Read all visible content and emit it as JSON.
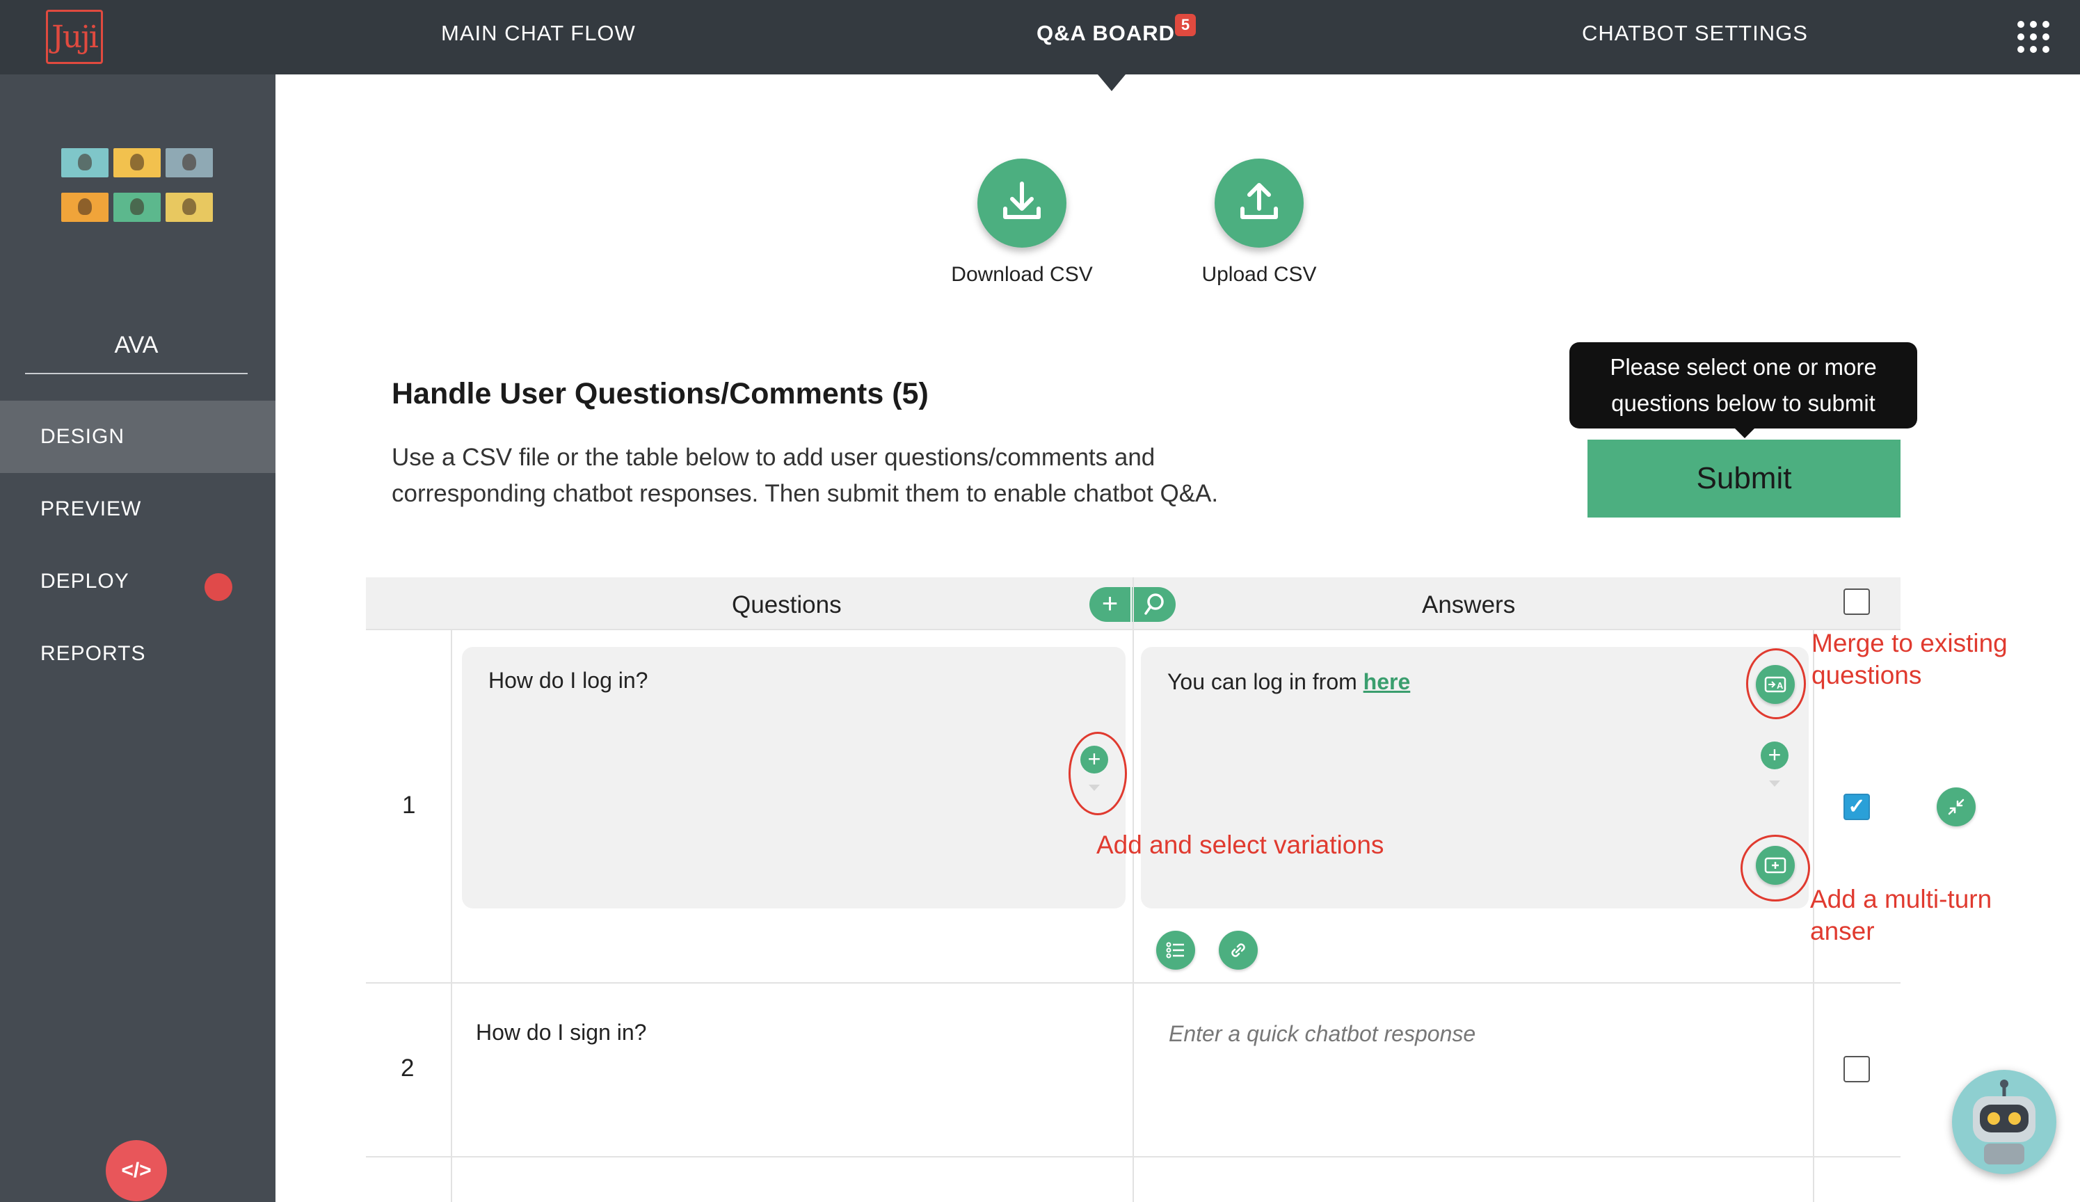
{
  "app": {
    "logo_text": "Juji"
  },
  "topnav": {
    "main_chat_flow": "MAIN CHAT FLOW",
    "qa_board": "Q&A BOARD",
    "qa_badge": "5",
    "chatbot_settings": "CHATBOT SETTINGS",
    "apps_icon": "apps-grid-icon"
  },
  "sidebar": {
    "assistant_name": "AVA",
    "items": [
      {
        "label": "DESIGN",
        "active": true
      },
      {
        "label": "PREVIEW",
        "active": false
      },
      {
        "label": "DEPLOY",
        "active": false,
        "status_color": "#e04a4a"
      },
      {
        "label": "REPORTS",
        "active": false
      }
    ],
    "code_button": "</>"
  },
  "csv": {
    "download_label": "Download CSV",
    "upload_label": "Upload CSV"
  },
  "section": {
    "title": "Handle User Questions/Comments (5)",
    "description": "Use a CSV file or the table below to add user questions/comments and corresponding chatbot responses. Then submit them to enable chatbot Q&A."
  },
  "submit": {
    "tooltip": "Please select one or more questions below to submit",
    "label": "Submit"
  },
  "table": {
    "col_questions": "Questions",
    "col_answers": "Answers",
    "add_symbol": "+",
    "rows": [
      {
        "num": "1",
        "question": "How do I log in?",
        "answer_prefix": "You can log in from ",
        "answer_link": "here",
        "checked": true
      },
      {
        "num": "2",
        "question": "How do I sign in?",
        "answer_placeholder": "Enter a quick chatbot response",
        "checked": false
      }
    ]
  },
  "annotations": {
    "merge": "Merge to existing questions",
    "variations": "Add and select variations",
    "multiturn": "Add a multi-turn anser"
  },
  "colors": {
    "accent": "#4caf80",
    "topbar": "#343a40",
    "sidebar": "#454b52",
    "annotation": "#e03a2f"
  }
}
